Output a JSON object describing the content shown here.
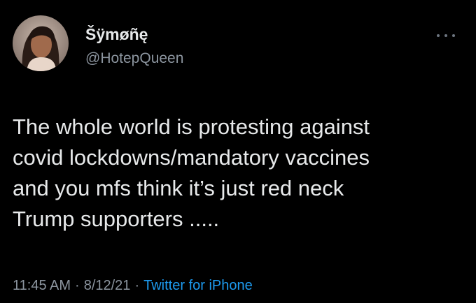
{
  "tweet": {
    "display_name": "Šÿmøñę",
    "handle": "@HotepQueen",
    "text_lines": [
      "The whole world is protesting against",
      "covid lockdowns/mandatory vaccines",
      "and you mfs think it’s just red neck",
      "Trump supporters ....."
    ],
    "time": "11:45 AM",
    "separator": "·",
    "date": "8/12/21",
    "source": "Twitter for iPhone"
  },
  "icons": {
    "more": "more-horizontal-icon",
    "avatar": "user-avatar"
  },
  "colors": {
    "background": "#000000",
    "text": "#e7e9ea",
    "secondary": "#8b949e",
    "link": "#1d9bf0"
  }
}
